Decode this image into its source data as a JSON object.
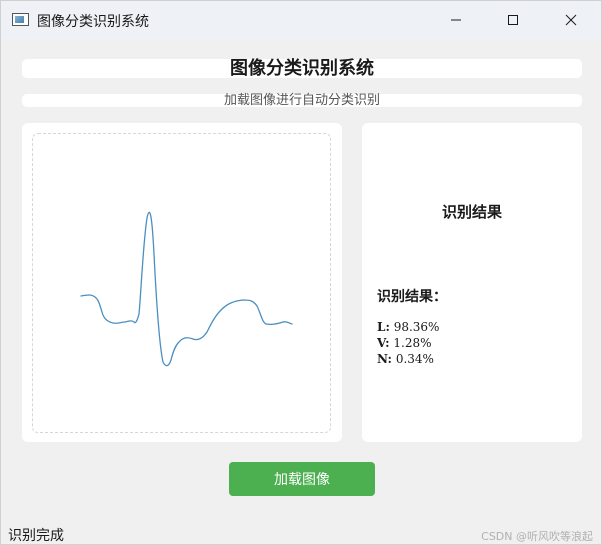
{
  "window": {
    "title": "图像分类识别系统",
    "icon": "app-image-icon"
  },
  "header": {
    "title": "图像分类识别系统",
    "subtitle": "加载图像进行自动分类识别"
  },
  "image_panel": {
    "content": "ecg-waveform-image"
  },
  "results": {
    "heading": "识别结果",
    "label": "识别结果：",
    "items": [
      {
        "cls": "L:",
        "value": "98.36%"
      },
      {
        "cls": "V:",
        "value": "1.28%"
      },
      {
        "cls": "N:",
        "value": "0.34%"
      }
    ]
  },
  "actions": {
    "load_label": "加载图像"
  },
  "status": {
    "text": "识别完成"
  },
  "watermark": "CSDN @听风吹等浪起",
  "colors": {
    "accent": "#4caf50",
    "waveform": "#4a8fc2"
  }
}
